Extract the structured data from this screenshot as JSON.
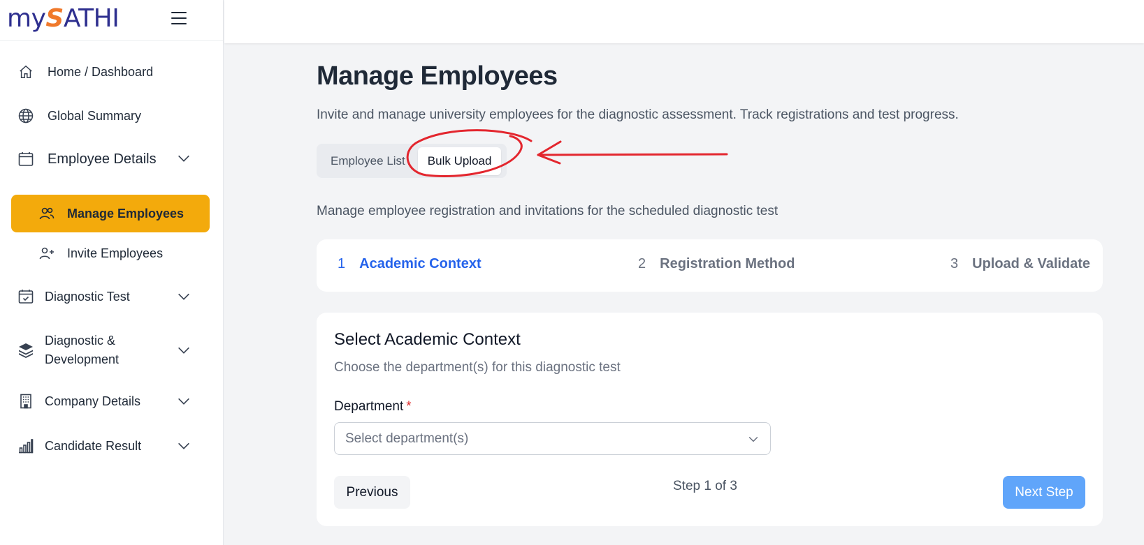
{
  "brand": {
    "logo_prefix": "my",
    "logo_s": "S",
    "logo_suffix": "ATHI"
  },
  "sidebar": {
    "items": [
      {
        "label": "Home / Dashboard",
        "icon": "home-icon"
      },
      {
        "label": "Global Summary",
        "icon": "globe-icon"
      },
      {
        "label": "Employee Details",
        "icon": "calendar-icon",
        "expanded": true,
        "children": [
          {
            "label": "Manage Employees",
            "icon": "users-icon",
            "active": true
          },
          {
            "label": "Invite Employees",
            "icon": "user-plus-icon"
          }
        ]
      },
      {
        "label": "Diagnostic Test",
        "icon": "calendar-check-icon"
      },
      {
        "label_line1": "Diagnostic &",
        "label_line2": "Development",
        "icon": "layers-icon"
      },
      {
        "label": "Company Details",
        "icon": "building-icon"
      },
      {
        "label": "Candidate Result",
        "icon": "bar-chart-icon"
      }
    ]
  },
  "main": {
    "title": "Manage Employees",
    "subtitle": "Invite and manage university employees for the diagnostic assessment. Track registrations and test progress.",
    "tabs": [
      {
        "label": "Employee List",
        "active": false
      },
      {
        "label": "Bulk Upload",
        "active": true
      }
    ],
    "section_desc": "Manage employee registration and invitations for the scheduled diagnostic test",
    "steps": [
      {
        "num": "1",
        "label": "Academic Context",
        "active": true
      },
      {
        "num": "2",
        "label": "Registration Method",
        "active": false
      },
      {
        "num": "3",
        "label": "Upload & Validate",
        "active": false
      }
    ],
    "card": {
      "title": "Select Academic Context",
      "subtitle": "Choose the department(s) for this diagnostic test",
      "field_label": "Department",
      "required_mark": "*",
      "select_placeholder": "Select department(s)",
      "prev_label": "Previous",
      "step_indicator": "Step 1 of 3",
      "next_label": "Next Step"
    }
  },
  "colors": {
    "accent_active": "#f3aa0c",
    "step_active": "#2563eb",
    "next_button": "#60a5fa",
    "annotation": "#e3262e"
  }
}
